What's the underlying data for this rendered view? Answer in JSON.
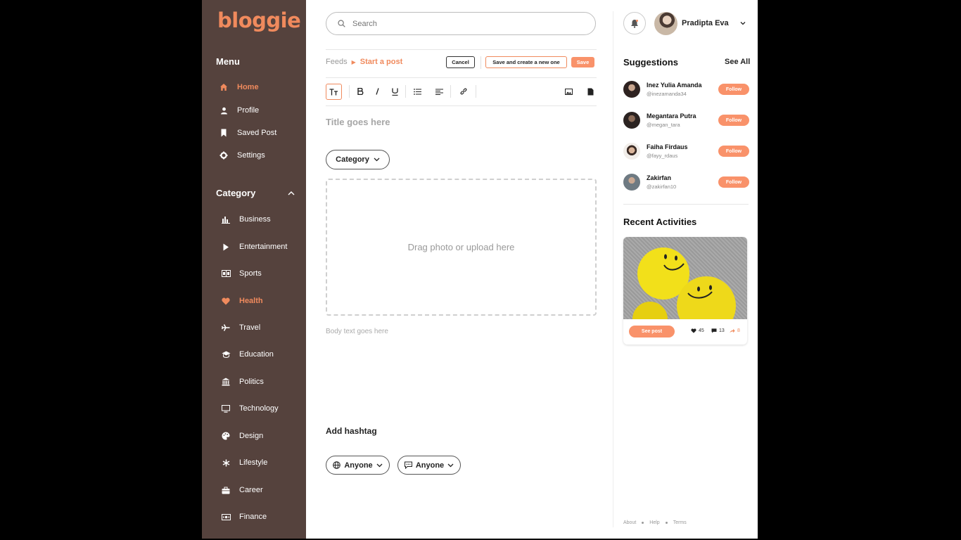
{
  "brand": {
    "logo_text": "bloggie",
    "accent": "#f08a5d",
    "sidebar_bg": "#55423d"
  },
  "menu": {
    "heading": "Menu",
    "items": [
      {
        "label": "Home",
        "icon": "home-icon",
        "active": true
      },
      {
        "label": "Profile",
        "icon": "user-icon",
        "active": false
      },
      {
        "label": "Saved Post",
        "icon": "bookmark-icon",
        "active": false
      },
      {
        "label": "Settings",
        "icon": "gear-icon",
        "active": false
      }
    ]
  },
  "category": {
    "heading": "Category",
    "items": [
      {
        "label": "Business",
        "icon": "bar-chart-icon",
        "active": false
      },
      {
        "label": "Entertainment",
        "icon": "play-icon",
        "active": false
      },
      {
        "label": "Sports",
        "icon": "scoreboard-icon",
        "active": false
      },
      {
        "label": "Health",
        "icon": "heart-icon",
        "active": true
      },
      {
        "label": "Travel",
        "icon": "plane-icon",
        "active": false
      },
      {
        "label": "Education",
        "icon": "graduation-cap-icon",
        "active": false
      },
      {
        "label": "Politics",
        "icon": "building-icon",
        "active": false
      },
      {
        "label": "Technology",
        "icon": "monitor-icon",
        "active": false
      },
      {
        "label": "Design",
        "icon": "palette-icon",
        "active": false
      },
      {
        "label": "Lifestyle",
        "icon": "asterisk-icon",
        "active": false
      },
      {
        "label": "Career",
        "icon": "briefcase-icon",
        "active": false
      },
      {
        "label": "Finance",
        "icon": "cash-icon",
        "active": false
      }
    ]
  },
  "search": {
    "placeholder": "Search"
  },
  "breadcrumb": {
    "root": "Feeds",
    "current": "Start a post"
  },
  "actions": {
    "cancel": "Cancel",
    "save_new": "Save and create a new one",
    "save": "Save"
  },
  "editor": {
    "title_placeholder": "Title goes here",
    "category_label": "Category",
    "upload_text": "Drag photo or upload here",
    "body_placeholder": "Body text goes here",
    "hashtag_label": "Add hashtag",
    "visibility": "Anyone",
    "comments": "Anyone"
  },
  "user": {
    "name": "Pradipta Eva"
  },
  "suggestions": {
    "title": "Suggestions",
    "see_all": "See All",
    "follow_label": "Follow",
    "people": [
      {
        "name": "Inez Yulia Amanda",
        "handle": "@inezamanda34"
      },
      {
        "name": "Megantara Putra",
        "handle": "@megan_tara"
      },
      {
        "name": "Faiha Firdaus",
        "handle": "@fayy_rdaus"
      },
      {
        "name": "Zakirfan",
        "handle": "@zakirfan10"
      }
    ]
  },
  "activities": {
    "title": "Recent Activities",
    "see_post": "See post",
    "likes": "45",
    "comments": "13",
    "shares": "8"
  },
  "footer": {
    "about": "About",
    "help": "Help",
    "terms": "Terms"
  }
}
